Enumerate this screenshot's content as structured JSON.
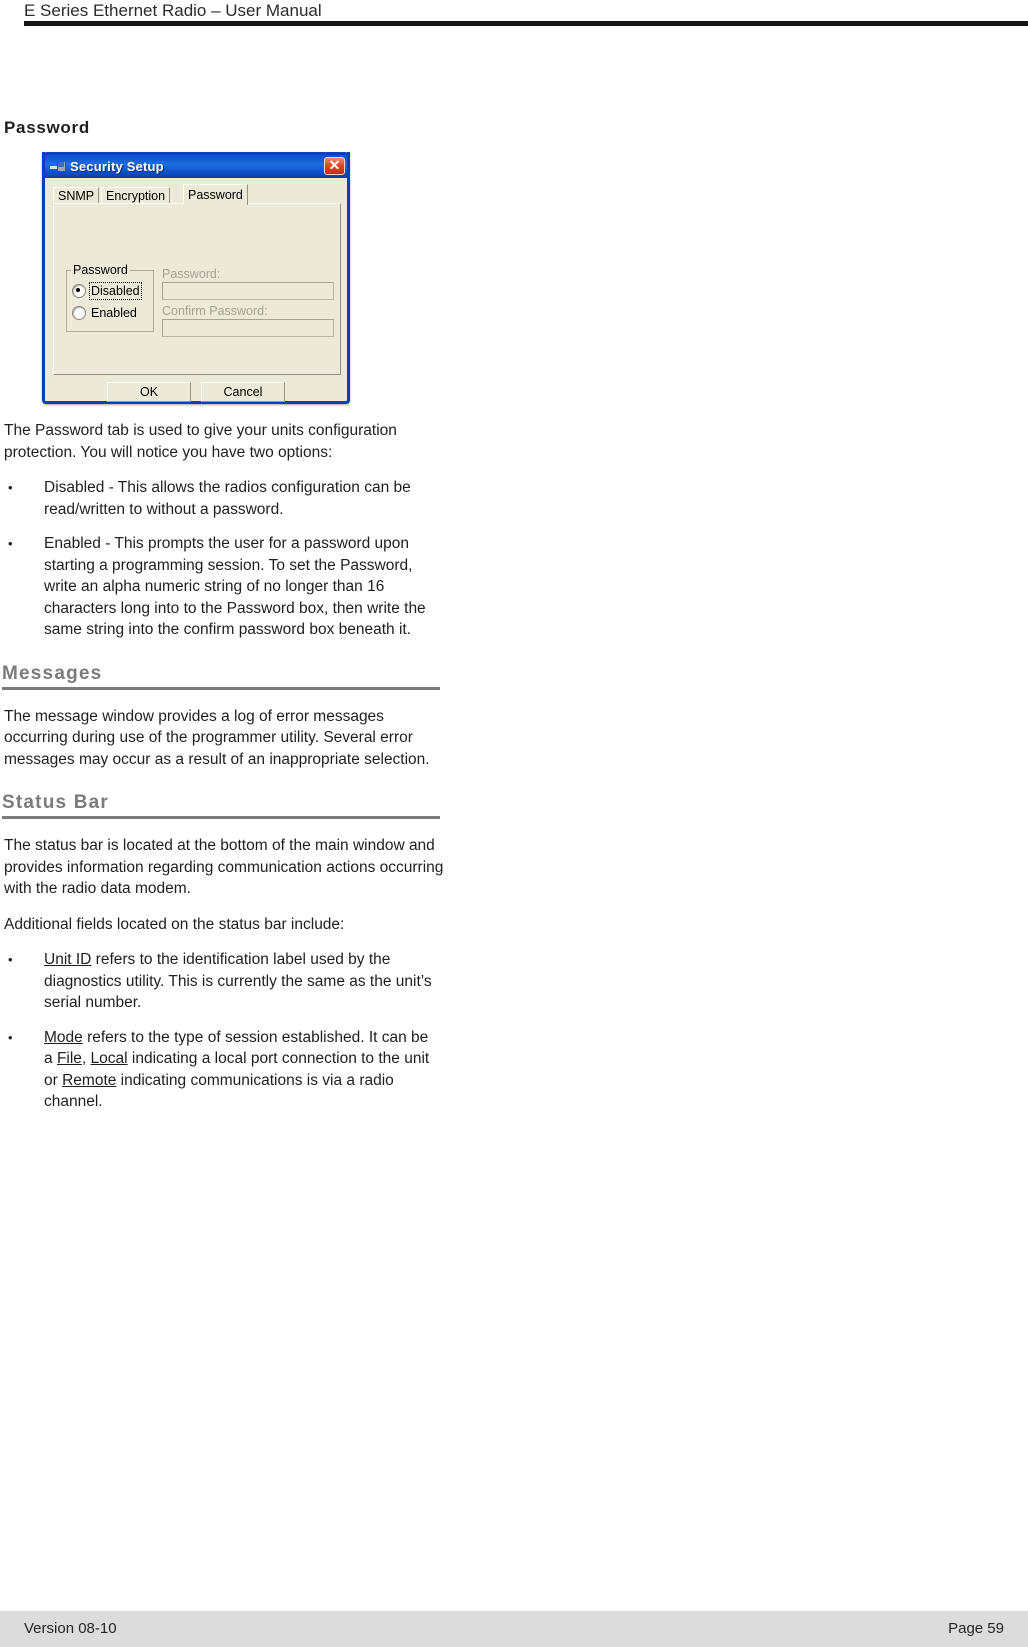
{
  "header": {
    "title": "E Series Ethernet Radio – User Manual"
  },
  "section": {
    "title": "Password"
  },
  "dialog": {
    "title": "Security Setup",
    "icon": "application-window-icon",
    "close_label": "✕",
    "tabs": [
      {
        "label": "SNMP",
        "active": false
      },
      {
        "label": "Encryption",
        "active": false
      },
      {
        "label": "Password",
        "active": true
      }
    ],
    "group": {
      "legend": "Password",
      "options": [
        {
          "label": "Disabled",
          "selected": true,
          "focused": true
        },
        {
          "label": "Enabled",
          "selected": false,
          "focused": false
        }
      ]
    },
    "fields": [
      {
        "label": "Password:",
        "value": "",
        "enabled": false
      },
      {
        "label": "Confirm Password:",
        "value": "",
        "enabled": false
      }
    ],
    "buttons": [
      {
        "label": "OK"
      },
      {
        "label": "Cancel"
      }
    ]
  },
  "body": {
    "intro": "The Password tab is used to give your units configuration protection. You will notice you have two options:",
    "bullet_disabled": "Disabled - This allows the radios configuration can be read/written to without a password.",
    "bullet_enabled": "Enabled - This  prompts the user for a password upon starting a programming session. To set the Password, write an alpha numeric string of no longer than 16 characters long into to the Password box, then write the same string into the confirm password box beneath it."
  },
  "messages": {
    "heading": "Messages",
    "paragraph": "The message window provides a log of error messages occurring during use of the programmer utility. Several error messages may occur as a result of an inappropriate selection."
  },
  "status_bar": {
    "heading": "Status Bar",
    "paragraph1": "The status bar is located at the bottom of the main window and provides information regarding communication actions occurring with the radio data modem.",
    "paragraph2": "Additional fields located on the status bar include:",
    "bullet_unit_id": {
      "term": "Unit ID",
      "rest": " refers to the identification label used by the diagnostics utility. This is currently the same as the unit’s serial number."
    },
    "bullet_mode": {
      "term": "Mode",
      "part1": " refers to the type of session established. It can be a ",
      "term2": "File",
      "part2": ", ",
      "term3": "Local",
      "part3": " indicating a local port connection to the unit or ",
      "term4": "Remote",
      "part4": " indicating communications is via a radio channel."
    }
  },
  "footer": {
    "version": "Version 08-10",
    "page": "Page 59"
  }
}
